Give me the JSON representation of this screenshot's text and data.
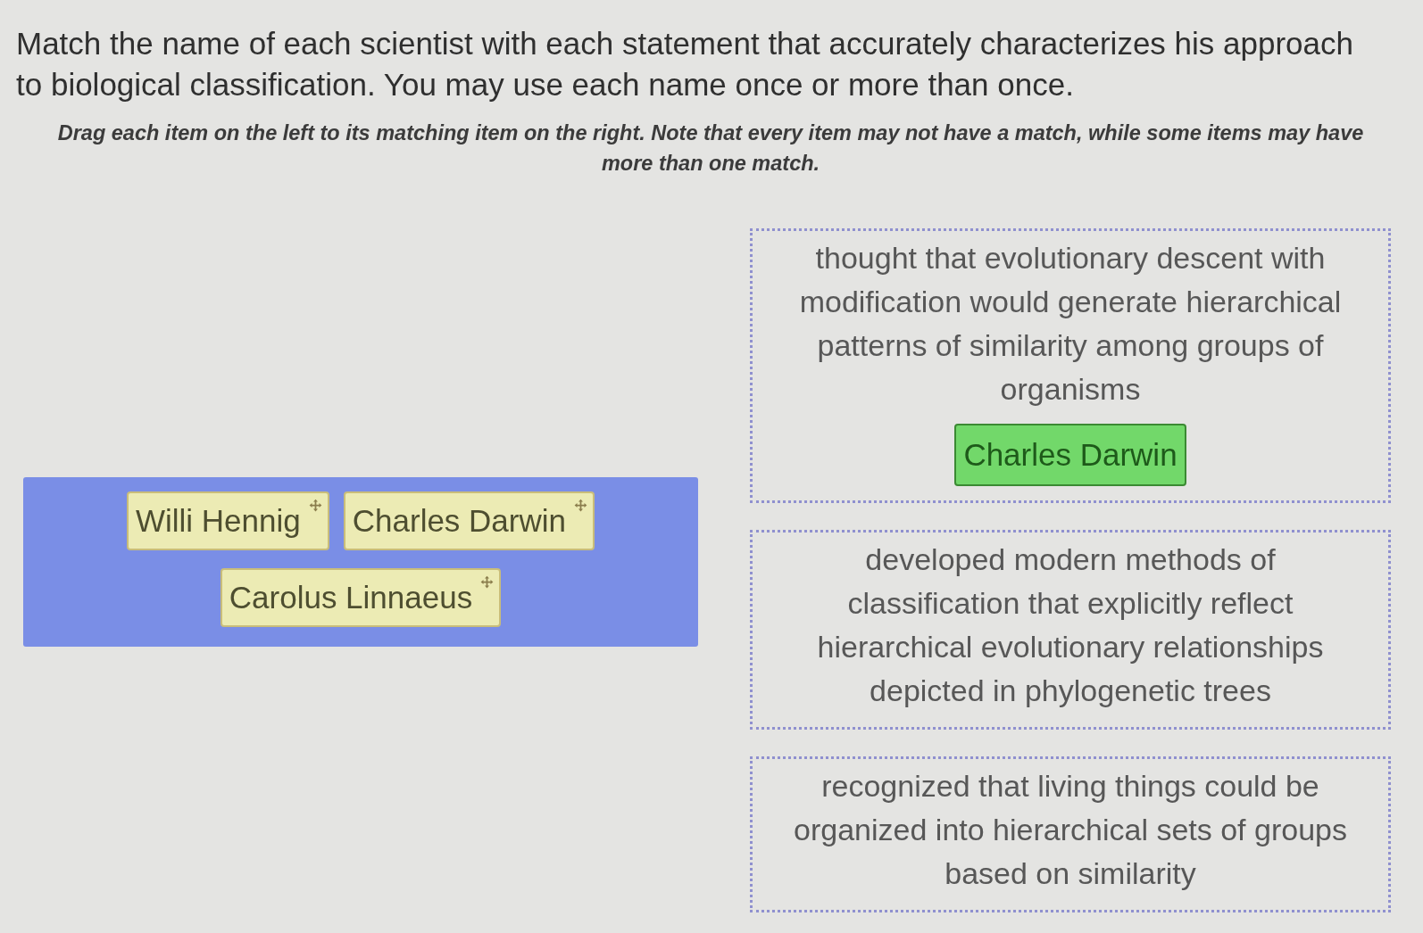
{
  "prompt": "Match the name of each scientist with each statement that accurately characterizes his approach to biological classification. You may use each name once or more than once.",
  "instructions": "Drag each item on the left to its matching item on the right. Note that every item may not have a match, while some items may have more than one match.",
  "items": [
    {
      "label": "Willi Hennig"
    },
    {
      "label": "Charles Darwin"
    },
    {
      "label": "Carolus Linnaeus"
    }
  ],
  "targets": [
    {
      "statement": "thought that evolutionary descent with modification would generate hierarchical patterns of similarity among groups of organisms",
      "placed": [
        {
          "label": "Charles Darwin",
          "correct": true
        }
      ]
    },
    {
      "statement": "developed modern methods of classification that explicitly reflect hierarchical evolutionary relationships depicted in phylogenetic trees"
    },
    {
      "statement": "recognized that living things could be organized into hierarchical sets of groups based on similarity"
    }
  ]
}
